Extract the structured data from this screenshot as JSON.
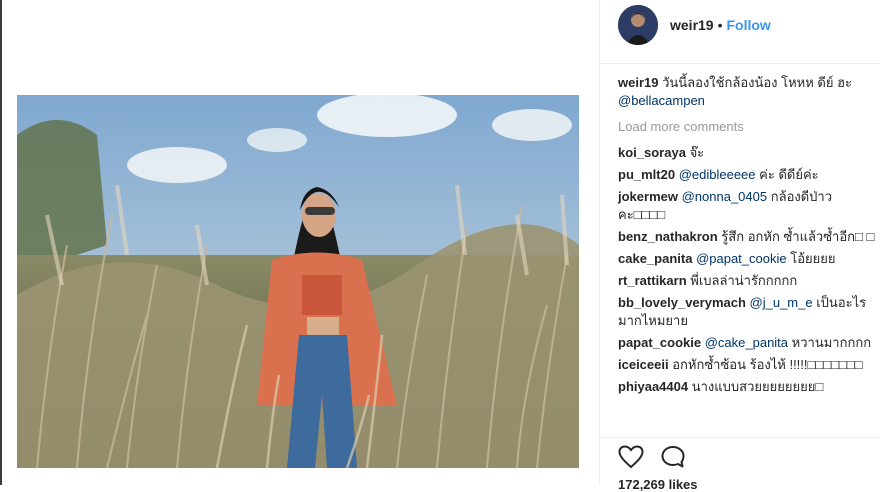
{
  "post": {
    "username": "weir19",
    "separator": "•",
    "follow_label": "Follow",
    "caption_user": "weir19",
    "caption_text": "วันนี้ลองใช้กล้องน้อง โหหห ดีย์ ฮะ",
    "caption_mention": "@bellacampen",
    "load_more": "Load more comments",
    "likes": "172,269 likes"
  },
  "comments": [
    {
      "user": "koi_soraya",
      "mention": "",
      "text": "จ๊ะ"
    },
    {
      "user": "pu_mlt20",
      "mention": "@edibleeeee",
      "text": "ค่ะ ดีดีย์ค่ะ"
    },
    {
      "user": "jokermew",
      "mention": "@nonna_0405",
      "text": "กล้องดีป่าว คะ□□□□"
    },
    {
      "user": "benz_nathakron",
      "mention": "",
      "text": "รู้สึก อกหัก ซ้ำแล้วซ้ำอีก□ □"
    },
    {
      "user": "cake_panita",
      "mention": "@papat_cookie",
      "text": "โอ้ยยยย"
    },
    {
      "user": "rt_rattikarn",
      "mention": "",
      "text": "พี่เบลล่าน่ารักกกกก"
    },
    {
      "user": "bb_lovely_verymach",
      "mention": "@j_u_m_e",
      "text": "เป็นอะไร มากไหมยาย"
    },
    {
      "user": "papat_cookie",
      "mention": "@cake_panita",
      "text": "หวานมากกกก"
    },
    {
      "user": "iceiceeii",
      "mention": "",
      "text": "อกหักซ้ำซ้อน ร้องไห้ !!!!!□□□□□□□"
    },
    {
      "user": "phiyaa4404",
      "mention": "",
      "text": "นางแบบสวยยยยยยยย□"
    }
  ],
  "icons": {
    "like": "heart-icon",
    "comment": "comment-icon"
  }
}
